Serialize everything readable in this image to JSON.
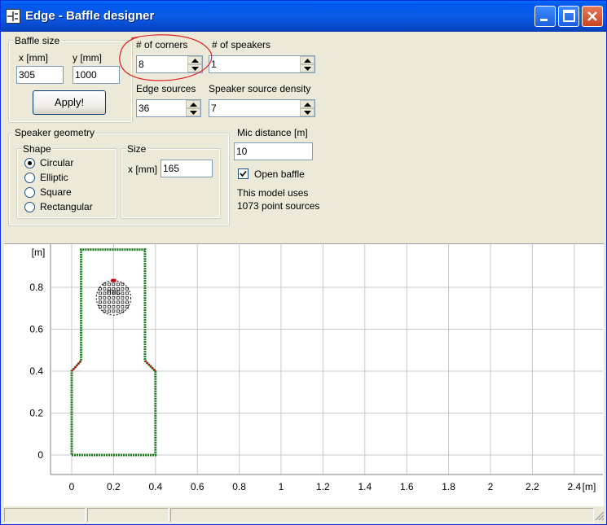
{
  "window": {
    "title": "Edge - Baffle designer"
  },
  "baffle_size": {
    "legend": "Baffle size",
    "x_label": "x [mm]",
    "x_value": "305",
    "y_label": "y [mm]",
    "y_value": "1000",
    "apply_label": "Apply!"
  },
  "corners": {
    "label": "# of corners",
    "value": "8"
  },
  "speakers": {
    "label": "# of speakers",
    "value": "1"
  },
  "edge_sources": {
    "label": "Edge sources",
    "value": "36"
  },
  "speaker_density": {
    "label": "Speaker source density",
    "value": "7"
  },
  "speaker_geometry": {
    "legend": "Speaker geometry",
    "shape_legend": "Shape",
    "shapes": [
      {
        "label": "Circular",
        "selected": true
      },
      {
        "label": "Elliptic",
        "selected": false
      },
      {
        "label": "Square",
        "selected": false
      },
      {
        "label": "Rectangular",
        "selected": false
      }
    ],
    "size_legend": "Size",
    "size_label": "x [mm]",
    "size_value": "165"
  },
  "mic": {
    "label": "Mic distance [m]",
    "value": "10",
    "open_baffle_label": "Open baffle",
    "open_baffle_checked": true,
    "info_line1": "This model uses",
    "info_line2": "1073 point sources"
  },
  "chart_data": {
    "type": "line",
    "ylabel": "[m]",
    "xlabel": "[m]",
    "xlim": [
      -0.1,
      2.5
    ],
    "ylim": [
      -0.1,
      0.95
    ],
    "x_ticks": [
      "0",
      "0.2",
      "0.4",
      "0.6",
      "0.8",
      "1",
      "1.2",
      "1.4",
      "1.6",
      "1.8",
      "2",
      "2.2",
      "2.4"
    ],
    "y_ticks": [
      "0",
      "0.2",
      "0.4",
      "0.6",
      "0.8"
    ],
    "grid": true,
    "baffle_outline": [
      [
        0.0,
        0.0
      ],
      [
        0.4,
        0.0
      ],
      [
        0.4,
        0.4
      ],
      [
        0.35,
        0.45
      ],
      [
        0.35,
        0.98
      ],
      [
        0.045,
        0.98
      ],
      [
        0.045,
        0.45
      ],
      [
        0.0,
        0.4
      ],
      [
        0.0,
        0.0
      ]
    ],
    "speaker": {
      "center": [
        0.2,
        0.75
      ],
      "diameter": 0.165,
      "label": "mic"
    },
    "colors": {
      "outline": "#1E7A1E",
      "corner": "#CC0000",
      "speaker": "#000000"
    }
  }
}
